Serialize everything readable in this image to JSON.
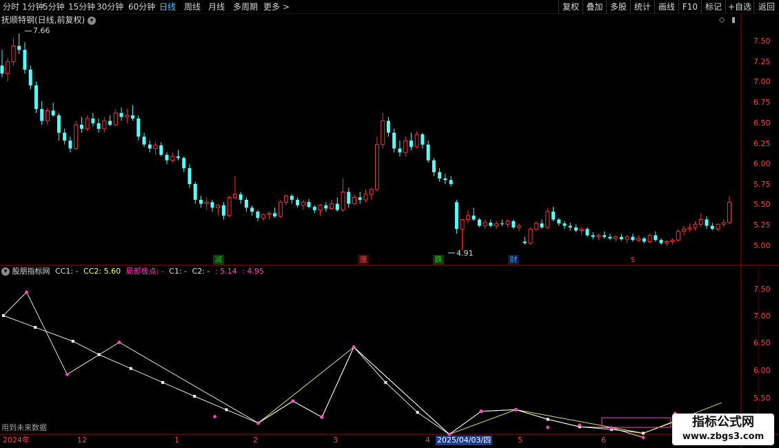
{
  "toolbar": {
    "left_items": [
      "分时",
      "1分钟",
      "5分钟",
      "15分钟",
      "30分钟",
      "60分钟",
      "日线",
      "周线",
      "月线",
      "多周期",
      "更多 >"
    ],
    "active_index": 6,
    "right_items": [
      "复权",
      "叠加",
      "多股",
      "统计",
      "画线",
      "F10",
      "标记",
      "+自选",
      "返回"
    ]
  },
  "price_panel": {
    "title": "抚顺特钢(日线,前复权)",
    "high_marker": "7.66",
    "low_marker": "4.91",
    "ticks": [
      "7.50",
      "7.25",
      "7.00",
      "6.75",
      "6.50",
      "6.25",
      "6.00",
      "5.75",
      "5.50",
      "5.25",
      "5.00"
    ],
    "events": [
      {
        "text": "减",
        "color": "#22aa22",
        "bg": "#0c3a0c"
      },
      {
        "text": "涨",
        "color": "#ff5050",
        "bg": "#3a0c0c"
      },
      {
        "text": "跌",
        "color": "#22cc22",
        "bg": "#0c3a0c"
      },
      {
        "text": "财",
        "color": "#3aa0ff",
        "bg": "#0c1c3a"
      },
      {
        "text": "$",
        "color": "#ff3030",
        "bg": "#000000"
      }
    ]
  },
  "indicator_panel": {
    "name": "股朋指标网",
    "cc1": "CC1: -",
    "cc2": "CC2: 5.60",
    "local_extreme": "局部极点: -",
    "c1": "C1: -",
    "c2": "C2: -",
    "val1": ": 5.14",
    "val2": ": 4.95",
    "ticks": [
      "7.50",
      "7.00",
      "6.50",
      "6.00",
      "5.50"
    ],
    "future_note": "用到未来数据"
  },
  "date_axis": {
    "labels": [
      "2024年",
      "12",
      "1",
      "2",
      "3",
      "4",
      "2025/04/03/四",
      "5",
      "6"
    ]
  },
  "watermark": {
    "line1": "指标公式网",
    "line2": "www.zbgs3.com"
  },
  "colors": {
    "up": "#ff3030",
    "down": "#54ffff",
    "border": "#b00000",
    "white_line": "#ffffff",
    "yellow_line": "#ffff66",
    "pivot": "#ff40c0"
  },
  "chart_data": [
    {
      "type": "candlestick",
      "ylim": [
        4.85,
        7.75
      ],
      "ohlc": [
        [
          7.25,
          7.45,
          7.1,
          7.15
        ],
        [
          7.15,
          7.35,
          7.05,
          7.3
        ],
        [
          7.3,
          7.6,
          7.25,
          7.5
        ],
        [
          7.5,
          7.66,
          7.4,
          7.45
        ],
        [
          7.45,
          7.55,
          7.15,
          7.2
        ],
        [
          7.2,
          7.25,
          6.95,
          7.0
        ],
        [
          7.0,
          7.05,
          6.65,
          6.7
        ],
        [
          6.7,
          6.8,
          6.5,
          6.55
        ],
        [
          6.55,
          6.72,
          6.5,
          6.68
        ],
        [
          6.68,
          6.78,
          6.6,
          6.62
        ],
        [
          6.62,
          6.65,
          6.3,
          6.4
        ],
        [
          6.4,
          6.45,
          6.25,
          6.3
        ],
        [
          6.3,
          6.35,
          6.15,
          6.2
        ],
        [
          6.2,
          6.55,
          6.18,
          6.5
        ],
        [
          6.5,
          6.6,
          6.4,
          6.45
        ],
        [
          6.45,
          6.62,
          6.42,
          6.58
        ],
        [
          6.58,
          6.65,
          6.48,
          6.52
        ],
        [
          6.52,
          6.58,
          6.4,
          6.45
        ],
        [
          6.45,
          6.6,
          6.4,
          6.55
        ],
        [
          6.55,
          6.62,
          6.48,
          6.5
        ],
        [
          6.5,
          6.7,
          6.48,
          6.65
        ],
        [
          6.65,
          6.72,
          6.55,
          6.6
        ],
        [
          6.6,
          6.7,
          6.52,
          6.62
        ],
        [
          6.62,
          6.75,
          6.55,
          6.58
        ],
        [
          6.58,
          6.62,
          6.3,
          6.35
        ],
        [
          6.35,
          6.4,
          6.22,
          6.25
        ],
        [
          6.25,
          6.3,
          6.15,
          6.2
        ],
        [
          6.2,
          6.28,
          6.12,
          6.24
        ],
        [
          6.24,
          6.28,
          6.1,
          6.12
        ],
        [
          6.12,
          6.15,
          6.0,
          6.05
        ],
        [
          6.05,
          6.15,
          6.02,
          6.1
        ],
        [
          6.1,
          6.18,
          6.05,
          6.08
        ],
        [
          6.08,
          6.1,
          5.9,
          5.95
        ],
        [
          5.95,
          6.0,
          5.7,
          5.75
        ],
        [
          5.75,
          5.78,
          5.5,
          5.55
        ],
        [
          5.55,
          5.6,
          5.45,
          5.5
        ],
        [
          5.5,
          5.58,
          5.42,
          5.52
        ],
        [
          5.52,
          5.55,
          5.4,
          5.45
        ],
        [
          5.45,
          5.5,
          5.35,
          5.48
        ],
        [
          5.48,
          5.52,
          5.3,
          5.35
        ],
        [
          5.35,
          5.6,
          5.33,
          5.58
        ],
        [
          5.58,
          5.85,
          5.55,
          5.62
        ],
        [
          5.62,
          5.65,
          5.5,
          5.55
        ],
        [
          5.55,
          5.58,
          5.4,
          5.45
        ],
        [
          5.45,
          5.48,
          5.35,
          5.4
        ],
        [
          5.4,
          5.42,
          5.28,
          5.32
        ],
        [
          5.32,
          5.38,
          5.28,
          5.36
        ],
        [
          5.36,
          5.4,
          5.3,
          5.38
        ],
        [
          5.38,
          5.45,
          5.32,
          5.34
        ],
        [
          5.34,
          5.55,
          5.32,
          5.52
        ],
        [
          5.52,
          5.62,
          5.48,
          5.6
        ],
        [
          5.6,
          5.62,
          5.5,
          5.55
        ],
        [
          5.55,
          5.58,
          5.45,
          5.48
        ],
        [
          5.48,
          5.55,
          5.42,
          5.52
        ],
        [
          5.52,
          5.56,
          5.44,
          5.46
        ],
        [
          5.46,
          5.48,
          5.38,
          5.42
        ],
        [
          5.42,
          5.5,
          5.35,
          5.48
        ],
        [
          5.48,
          5.52,
          5.4,
          5.44
        ],
        [
          5.44,
          5.55,
          5.42,
          5.5
        ],
        [
          5.5,
          5.58,
          5.4,
          5.42
        ],
        [
          5.42,
          5.82,
          5.4,
          5.65
        ],
        [
          5.65,
          5.7,
          5.45,
          5.5
        ],
        [
          5.5,
          5.62,
          5.48,
          5.58
        ],
        [
          5.58,
          5.65,
          5.5,
          5.55
        ],
        [
          5.55,
          5.68,
          5.52,
          5.62
        ],
        [
          5.62,
          5.7,
          5.55,
          5.68
        ],
        [
          5.68,
          6.35,
          5.65,
          6.25
        ],
        [
          6.25,
          6.65,
          6.2,
          6.55
        ],
        [
          6.55,
          6.6,
          6.35,
          6.4
        ],
        [
          6.4,
          6.45,
          6.15,
          6.2
        ],
        [
          6.2,
          6.3,
          6.1,
          6.15
        ],
        [
          6.15,
          6.35,
          6.1,
          6.3
        ],
        [
          6.3,
          6.4,
          6.18,
          6.22
        ],
        [
          6.22,
          6.42,
          6.2,
          6.38
        ],
        [
          6.38,
          6.4,
          6.2,
          6.25
        ],
        [
          6.25,
          6.3,
          6.02,
          6.05
        ],
        [
          6.05,
          6.08,
          5.85,
          5.9
        ],
        [
          5.9,
          5.95,
          5.78,
          5.82
        ],
        [
          5.82,
          5.88,
          5.75,
          5.8
        ],
        [
          5.8,
          5.85,
          5.72,
          5.75
        ],
        [
          5.52,
          5.55,
          5.12,
          5.18
        ],
        [
          5.18,
          5.25,
          4.91,
          5.3
        ],
        [
          5.3,
          5.42,
          5.25,
          5.35
        ],
        [
          5.35,
          5.45,
          5.28,
          5.3
        ],
        [
          5.3,
          5.32,
          5.2,
          5.22
        ],
        [
          5.22,
          5.3,
          5.18,
          5.26
        ],
        [
          5.26,
          5.3,
          5.2,
          5.22
        ],
        [
          5.22,
          5.28,
          5.18,
          5.25
        ],
        [
          5.25,
          5.3,
          5.22,
          5.24
        ],
        [
          5.24,
          5.3,
          5.2,
          5.28
        ],
        [
          5.28,
          5.3,
          5.18,
          5.2
        ],
        [
          5.2,
          5.25,
          5.15,
          5.22
        ],
        [
          5.02,
          5.08,
          4.98,
          5.0
        ],
        [
          5.0,
          5.2,
          4.98,
          5.18
        ],
        [
          5.18,
          5.28,
          5.15,
          5.25
        ],
        [
          5.25,
          5.3,
          5.18,
          5.2
        ],
        [
          5.2,
          5.45,
          5.18,
          5.4
        ],
        [
          5.4,
          5.46,
          5.28,
          5.3
        ],
        [
          5.3,
          5.32,
          5.22,
          5.25
        ],
        [
          5.25,
          5.28,
          5.18,
          5.22
        ],
        [
          5.22,
          5.26,
          5.16,
          5.2
        ],
        [
          5.2,
          5.24,
          5.14,
          5.16
        ],
        [
          5.16,
          5.2,
          5.1,
          5.18
        ],
        [
          5.18,
          5.2,
          5.08,
          5.1
        ],
        [
          5.1,
          5.14,
          5.05,
          5.08
        ],
        [
          5.08,
          5.12,
          5.04,
          5.1
        ],
        [
          5.1,
          5.15,
          5.06,
          5.08
        ],
        [
          5.08,
          5.12,
          5.04,
          5.06
        ],
        [
          5.06,
          5.1,
          5.02,
          5.08
        ],
        [
          5.08,
          5.12,
          5.03,
          5.05
        ],
        [
          5.05,
          5.1,
          5.0,
          5.08
        ],
        [
          5.08,
          5.12,
          5.02,
          5.04
        ],
        [
          5.04,
          5.1,
          5.01,
          5.06
        ],
        [
          5.06,
          5.08,
          5.0,
          5.02
        ],
        [
          5.02,
          5.12,
          5.0,
          5.1
        ],
        [
          5.1,
          5.15,
          5.02,
          5.04
        ],
        [
          5.04,
          5.06,
          4.98,
          5.0
        ],
        [
          5.0,
          5.04,
          4.96,
          5.02
        ],
        [
          5.02,
          5.06,
          4.98,
          5.04
        ],
        [
          5.04,
          5.18,
          5.02,
          5.15
        ],
        [
          5.15,
          5.22,
          5.1,
          5.18
        ],
        [
          5.18,
          5.25,
          5.14,
          5.2
        ],
        [
          5.2,
          5.28,
          5.16,
          5.24
        ],
        [
          5.24,
          5.38,
          5.2,
          5.3
        ],
        [
          5.3,
          5.34,
          5.18,
          5.22
        ],
        [
          5.22,
          5.26,
          5.16,
          5.18
        ],
        [
          5.18,
          5.25,
          5.15,
          5.24
        ],
        [
          5.24,
          5.3,
          5.2,
          5.26
        ],
        [
          5.26,
          5.6,
          5.24,
          5.52
        ]
      ]
    },
    {
      "type": "line",
      "title": "股朋指标网",
      "ylim": [
        5.05,
        7.95
      ],
      "series": [
        {
          "name": "CC2",
          "color": "#ffffff",
          "x": [
            0,
            11,
            24,
            33,
            44,
            55,
            66,
            77,
            88,
            100,
            110,
            121,
            132,
            143,
            154,
            165,
            177,
            188,
            199,
            210,
            221,
            232
          ],
          "values": [
            7.23,
            7.01,
            6.75,
            6.5,
            6.24,
            5.98,
            5.72,
            5.47,
            5.22,
            5.63,
            5.33,
            6.64,
            5.98,
            5.42,
            5.01,
            5.44,
            5.47,
            5.29,
            5.15,
            5.1,
            5.03,
            5.25
          ]
        },
        {
          "name": "CC1",
          "color": "#ffff66",
          "x": [
            88,
            121,
            154,
            177,
            221,
            248
          ],
          "values": [
            5.22,
            6.64,
            5.01,
            5.47,
            5.03,
            5.6
          ]
        },
        {
          "name": "局部极点",
          "color": "#ffffff",
          "x": [
            0,
            8,
            22,
            40,
            88,
            100,
            110,
            121,
            154,
            165,
            177,
            188,
            199,
            210,
            221
          ],
          "values": [
            7.23,
            7.67,
            6.13,
            6.73,
            5.22,
            5.63,
            5.33,
            6.64,
            5.01,
            5.44,
            5.47,
            5.29,
            5.15,
            5.13,
            4.95
          ]
        }
      ],
      "pivots": {
        "x": [
          8,
          22,
          40,
          73,
          88,
          100,
          110,
          121,
          154,
          165,
          177,
          188,
          199,
          210,
          221,
          232
        ],
        "values": [
          7.67,
          6.13,
          6.73,
          5.34,
          5.22,
          5.63,
          5.33,
          6.64,
          5.01,
          5.44,
          5.47,
          5.14,
          5.18,
          5.13,
          4.95,
          5.4
        ]
      }
    }
  ]
}
